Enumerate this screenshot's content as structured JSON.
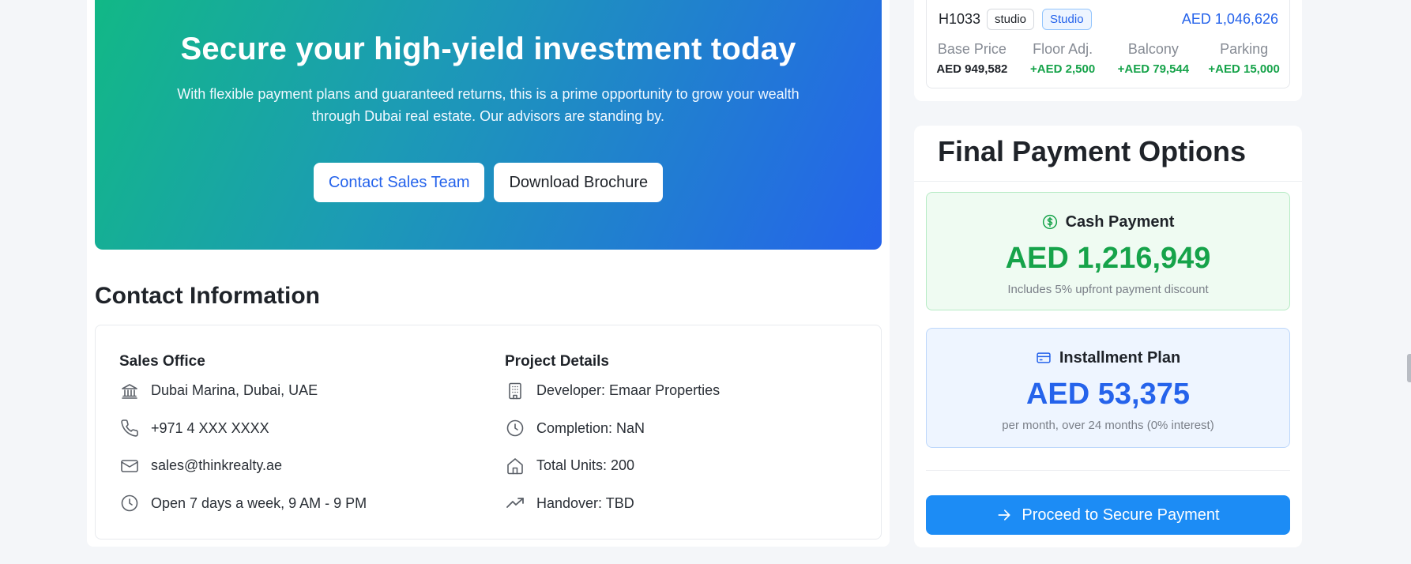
{
  "hero": {
    "title": "Secure your high-yield investment today",
    "description": "With flexible payment plans and guaranteed returns, this is a prime opportunity to grow your wealth through Dubai real estate. Our advisors are standing by.",
    "contact_button": "Contact Sales Team",
    "brochure_button": "Download Brochure"
  },
  "contact": {
    "title": "Contact Information",
    "sales_office": {
      "heading": "Sales Office",
      "address": "Dubai Marina, Dubai, UAE",
      "phone": "+971 4 XXX XXXX",
      "email": "sales@thinkrealty.ae",
      "hours": "Open 7 days a week, 9 AM - 9 PM"
    },
    "project": {
      "heading": "Project Details",
      "developer": "Developer: Emaar Properties",
      "completion": "Completion: NaN",
      "units": "Total Units: 200",
      "handover": "Handover: TBD"
    }
  },
  "unit": {
    "code": "H1033",
    "tag_type": "studio",
    "tag_layout": "Studio",
    "price": "AED 1,046,626",
    "breakdown": [
      {
        "label": "Base Price",
        "value": "AED 949,582"
      },
      {
        "label": "Floor Adj.",
        "value": "+AED 2,500"
      },
      {
        "label": "Balcony",
        "value": "+AED 79,544"
      },
      {
        "label": "Parking",
        "value": "+AED 15,000"
      }
    ]
  },
  "payment": {
    "title": "Final Payment Options",
    "cash": {
      "label": "Cash Payment",
      "amount": "AED 1,216,949",
      "note": "Includes 5% upfront payment discount"
    },
    "installment": {
      "label": "Installment Plan",
      "amount": "AED 53,375",
      "note": "per month, over 24 months (0% interest)"
    },
    "proceed_button": "Proceed to Secure Payment"
  },
  "colors": {
    "accent_blue": "#2563eb",
    "accent_green": "#16a34a",
    "button_blue": "#1c8cf5",
    "hero_gradient_start": "#12b886",
    "hero_gradient_end": "#2563eb"
  }
}
